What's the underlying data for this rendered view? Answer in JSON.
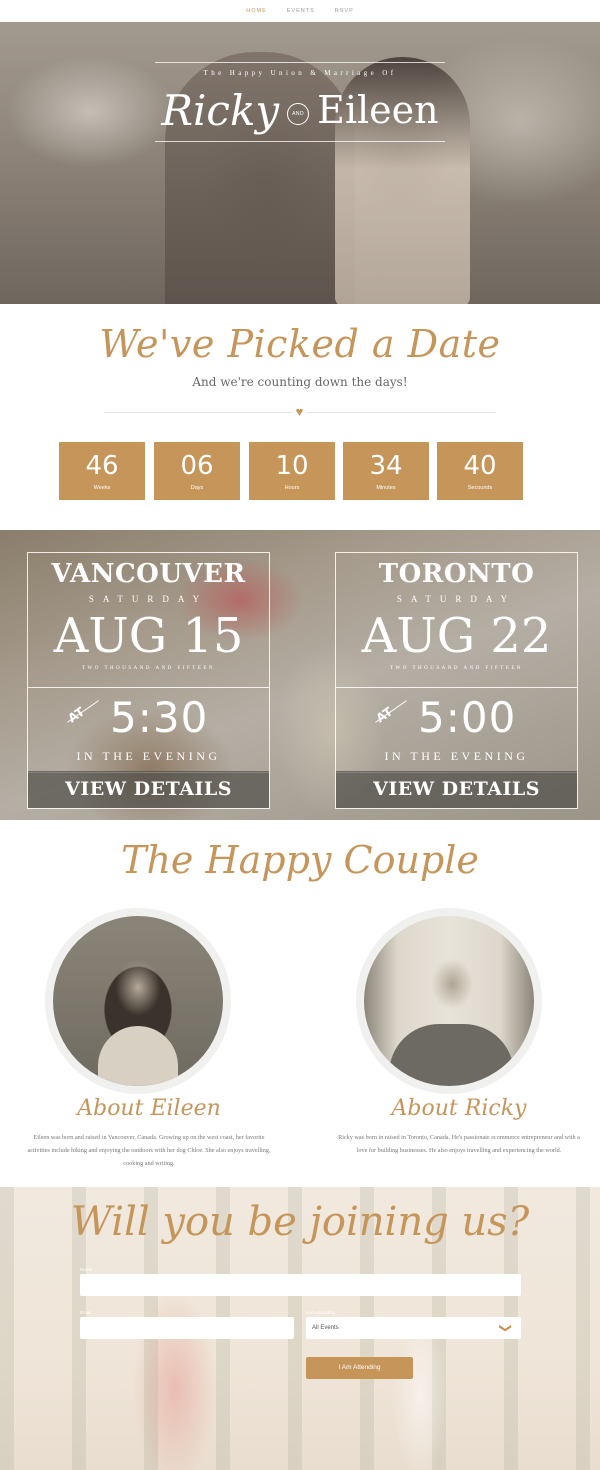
{
  "nav": {
    "items": [
      "HOME",
      "EVENTS",
      "RSVP"
    ]
  },
  "hero": {
    "kicker": "The Happy Union & Marriage Of",
    "name1": "Ricky",
    "and": "AND",
    "name2": "Eileen"
  },
  "date_section": {
    "title": "We've Picked a Date",
    "subtitle": "And we're counting down the days!",
    "heart_icon": "heart",
    "countdown": [
      {
        "value": "46",
        "label": "Weeks"
      },
      {
        "value": "06",
        "label": "Days"
      },
      {
        "value": "10",
        "label": "Hours"
      },
      {
        "value": "34",
        "label": "Minutes"
      },
      {
        "value": "40",
        "label": "Secounds"
      }
    ]
  },
  "events": [
    {
      "city": "VANCOUVER",
      "weekday": "SATURDAY",
      "date": "AUG 15",
      "year": "TWO THOUSAND AND FIFTEEN",
      "at": "AT",
      "time": "5:30",
      "period": "IN THE EVENING",
      "button": "VIEW DETAILS"
    },
    {
      "city": "TORONTO",
      "weekday": "SATURDAY",
      "date": "AUG 22",
      "year": "TWO THOUSAND AND FIFTEEN",
      "at": "AT",
      "time": "5:00",
      "period": "IN THE EVENING",
      "button": "VIEW DETAILS"
    }
  ],
  "couple": {
    "title": "The Happy Couple",
    "people": [
      {
        "heading": "About Eileen",
        "bio": "Eileen was born and raised in Vancouver, Canada. Growing up on the west coast, her favorite activities include hiking and enjoying the outdoors with her dog Chloe. She also enjoys travelling, cooking and writing."
      },
      {
        "heading": "About Ricky",
        "bio": "Ricky was born in raised in Toronto, Canada. He's passionate ecommerce entrepreneur and with a love for building businesses. He also enjoys travelling and experiencing the world."
      }
    ]
  },
  "rsvp": {
    "title": "Will you be joining us?",
    "name_label": "Name",
    "email_label": "Email",
    "attending_label": "I Am Attending",
    "attending_value": "All Events",
    "submit": "I Am Attending",
    "colors": {
      "accent": "#c6955a"
    }
  }
}
